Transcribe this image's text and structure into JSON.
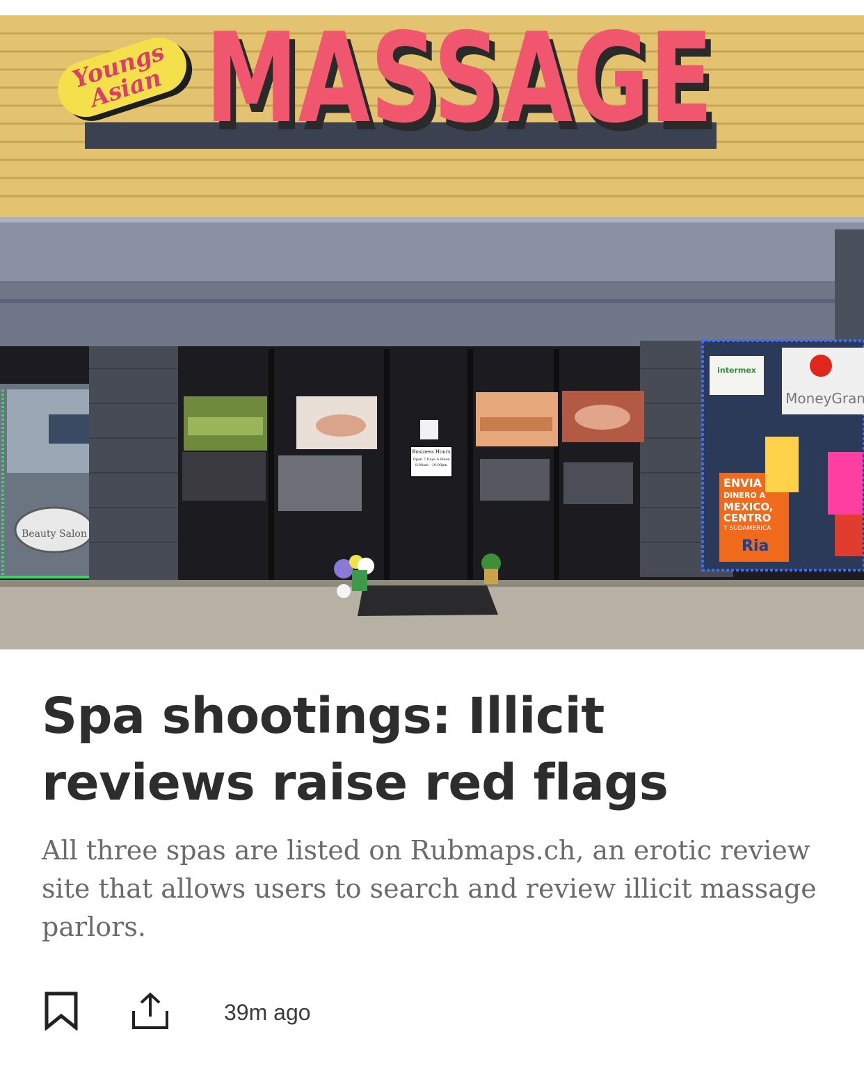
{
  "hero_image": {
    "sign_script": [
      "Youngs",
      "Asian"
    ],
    "sign_main": "MASSAGE",
    "door_sign": [
      "Business Hours",
      "Open 7 Days A Week",
      "8:00am - 10:00pm"
    ],
    "neighbor_sign_left": "Beauty Salon",
    "neighbor_store": {
      "brand1": "intermex",
      "brand2": "MoneyGram",
      "poster_lines": [
        "ENVIA",
        "DINERO A",
        "MEXICO,",
        "CENTRO",
        "Y SUDAMERICA"
      ],
      "poster_brand": "Ria"
    }
  },
  "article": {
    "headline": "Spa shootings: Illicit reviews raise red flags",
    "summary": "All three spas are listed on Rubmaps.ch, an erotic review site that allows users to search and review illicit massage parlors.",
    "timestamp": "39m ago"
  },
  "actions": {
    "bookmark_icon": "bookmark-icon",
    "share_icon": "share-icon"
  },
  "colors": {
    "headline": "#2d2d2d",
    "summary": "#6b6b6b",
    "sign_red": "#f0566e",
    "sign_yellow": "#f4e04a"
  }
}
